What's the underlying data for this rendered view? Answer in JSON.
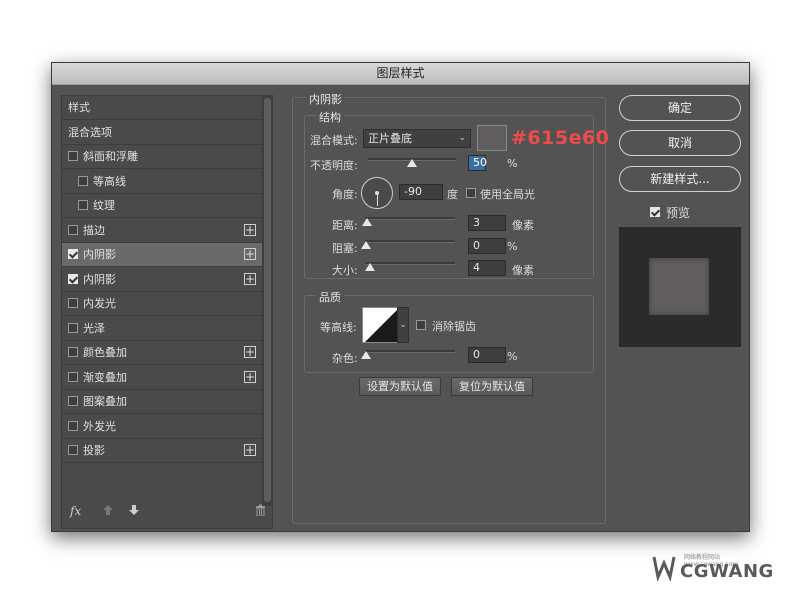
{
  "dialog": {
    "title": "图层样式"
  },
  "styles_list": {
    "items": [
      {
        "label": "样式",
        "checkbox": false,
        "checked": false,
        "plus": false,
        "indent": 0,
        "selected": false
      },
      {
        "label": "混合选项",
        "checkbox": false,
        "checked": false,
        "plus": false,
        "indent": 0,
        "selected": false
      },
      {
        "label": "斜面和浮雕",
        "checkbox": true,
        "checked": false,
        "plus": false,
        "indent": 0,
        "selected": false
      },
      {
        "label": "等高线",
        "checkbox": true,
        "checked": false,
        "plus": false,
        "indent": 1,
        "selected": false
      },
      {
        "label": "纹理",
        "checkbox": true,
        "checked": false,
        "plus": false,
        "indent": 1,
        "selected": false
      },
      {
        "label": "描边",
        "checkbox": true,
        "checked": false,
        "plus": true,
        "indent": 0,
        "selected": false
      },
      {
        "label": "内阴影",
        "checkbox": true,
        "checked": true,
        "plus": true,
        "indent": 0,
        "selected": true
      },
      {
        "label": "内阴影",
        "checkbox": true,
        "checked": true,
        "plus": true,
        "indent": 0,
        "selected": false
      },
      {
        "label": "内发光",
        "checkbox": true,
        "checked": false,
        "plus": false,
        "indent": 0,
        "selected": false
      },
      {
        "label": "光泽",
        "checkbox": true,
        "checked": false,
        "plus": false,
        "indent": 0,
        "selected": false
      },
      {
        "label": "颜色叠加",
        "checkbox": true,
        "checked": false,
        "plus": true,
        "indent": 0,
        "selected": false
      },
      {
        "label": "渐变叠加",
        "checkbox": true,
        "checked": false,
        "plus": true,
        "indent": 0,
        "selected": false
      },
      {
        "label": "图案叠加",
        "checkbox": true,
        "checked": false,
        "plus": false,
        "indent": 0,
        "selected": false
      },
      {
        "label": "外发光",
        "checkbox": true,
        "checked": false,
        "plus": false,
        "indent": 0,
        "selected": false
      },
      {
        "label": "投影",
        "checkbox": true,
        "checked": false,
        "plus": true,
        "indent": 0,
        "selected": false
      }
    ],
    "footer": {
      "fx": "fx",
      "up_icon": "arrow-up-icon",
      "down_icon": "arrow-down-icon",
      "trash_icon": "trash-icon"
    }
  },
  "inner_shadow": {
    "section_title": "内阴影",
    "structure_title": "结构",
    "blend_mode_label": "混合模式:",
    "blend_mode_value": "正片叠底",
    "color_hex_annotation": "#615e60",
    "shadow_color": "#615e60",
    "opacity_label": "不透明度:",
    "opacity_value": "50",
    "opacity_unit": "%",
    "opacity_slider": 0.5,
    "angle_label": "角度:",
    "angle_value": "-90",
    "angle_unit": "度",
    "global_light_label": "使用全局光",
    "global_light_checked": false,
    "distance_label": "距离:",
    "distance_value": "3",
    "distance_unit": "像素",
    "choke_label": "阻塞:",
    "choke_value": "0",
    "choke_unit": "%",
    "size_label": "大小:",
    "size_value": "4",
    "size_unit": "像素",
    "quality_title": "品质",
    "contour_label": "等高线:",
    "anti_alias_label": "消除锯齿",
    "anti_alias_checked": false,
    "noise_label": "杂色:",
    "noise_value": "0",
    "noise_unit": "%",
    "set_default_label": "设置为默认值",
    "reset_default_label": "复位为默认值"
  },
  "actions": {
    "ok_label": "确定",
    "cancel_label": "取消",
    "new_style_label": "新建样式...",
    "preview_label": "预览",
    "preview_checked": true
  },
  "watermark": {
    "main": "CGWANG",
    "sub": "网络教程网站 www.cgwang.com"
  }
}
